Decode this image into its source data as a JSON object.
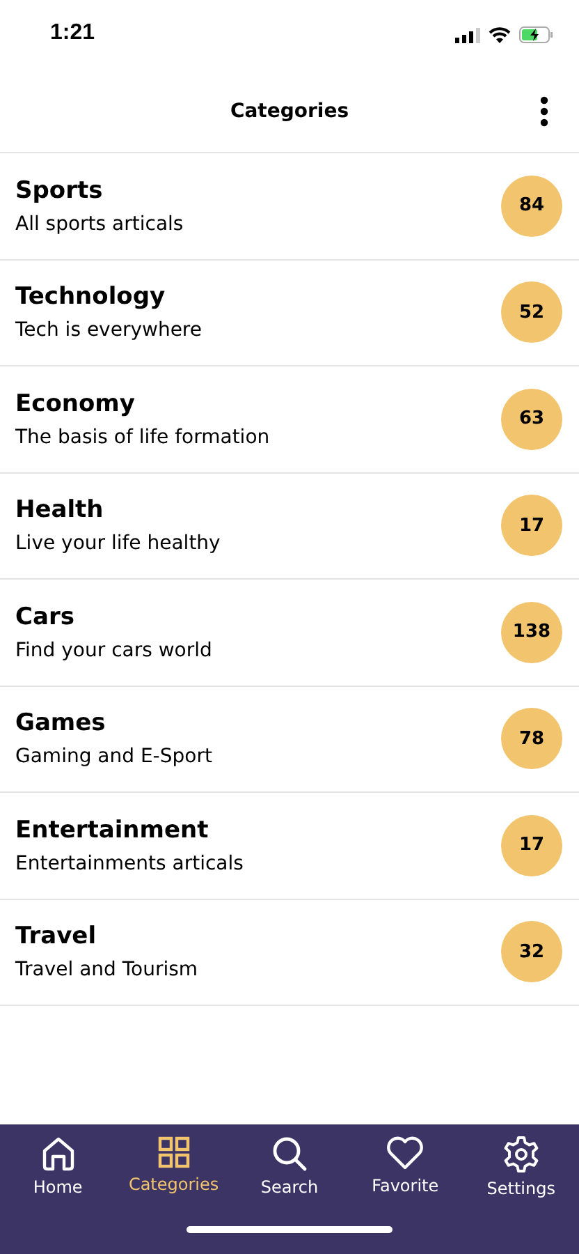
{
  "status_bar": {
    "time": "1:21"
  },
  "header": {
    "title": "Categories"
  },
  "categories": [
    {
      "name": "Sports",
      "description": "All sports articals",
      "count": "84"
    },
    {
      "name": "Technology",
      "description": "Tech is everywhere",
      "count": "52"
    },
    {
      "name": "Economy",
      "description": "The basis of life formation",
      "count": "63"
    },
    {
      "name": "Health",
      "description": "Live your life healthy",
      "count": "17"
    },
    {
      "name": "Cars",
      "description": "Find your cars world",
      "count": "138"
    },
    {
      "name": "Games",
      "description": "Gaming and E-Sport",
      "count": "78"
    },
    {
      "name": "Entertainment",
      "description": "Entertainments articals",
      "count": "17"
    },
    {
      "name": "Travel",
      "description": "Travel and Tourism",
      "count": "32"
    }
  ],
  "tab_bar": [
    {
      "kind": "home",
      "label": "Home",
      "selected": false
    },
    {
      "kind": "grid",
      "label": "Categories",
      "selected": true
    },
    {
      "kind": "search",
      "label": "Search",
      "selected": false
    },
    {
      "kind": "heart",
      "label": "Favorite",
      "selected": false
    },
    {
      "kind": "gear",
      "label": "Settings",
      "selected": false
    }
  ]
}
